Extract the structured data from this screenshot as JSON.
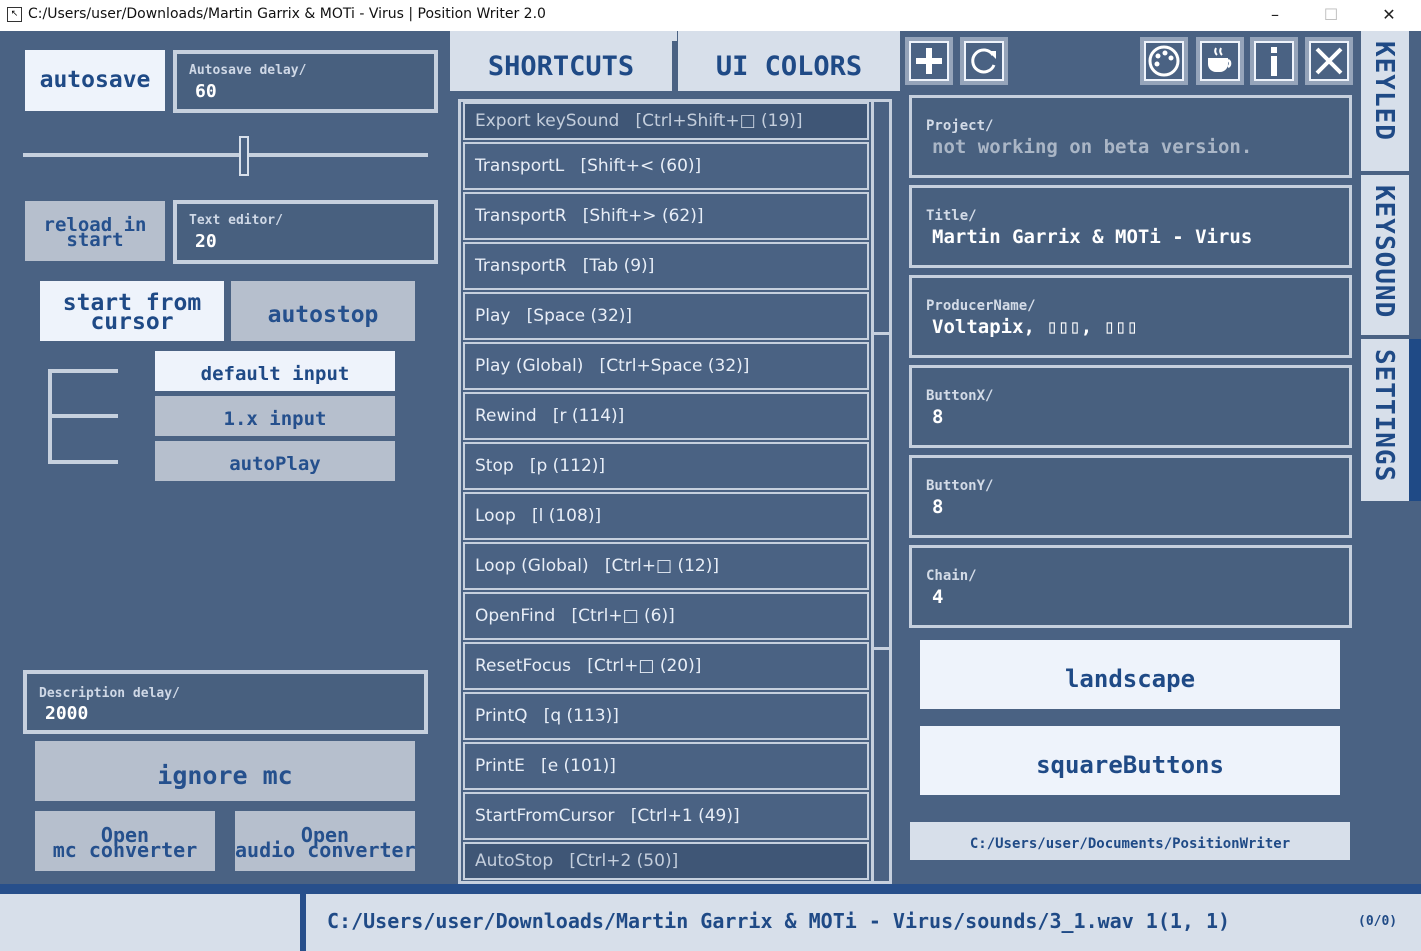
{
  "window": {
    "title": "C:/Users/user/Downloads/Martin Garrix & MOTi - Virus | Position Writer 2.0",
    "minimize_glyph": "–",
    "maximize_glyph": "☐",
    "close_glyph": "✕"
  },
  "left": {
    "autosave_label": "autosave",
    "autosave_delay": {
      "label": "Autosave delay/",
      "value": "60"
    },
    "slider_level": 0.55,
    "reload_label_1": "reload in",
    "reload_label_2": "start",
    "text_editor": {
      "label": "Text editor/",
      "value": "20"
    },
    "start_from_cursor_1": "start from",
    "start_from_cursor_2": "cursor",
    "autostop_label": "autostop",
    "input_options": [
      "default input",
      "1.x input",
      "autoPlay"
    ],
    "description_delay": {
      "label": "Description delay/",
      "value": "2000"
    },
    "ignore_mc_label": "ignore mc",
    "mc_converter_1": "Open",
    "mc_converter_2": "mc converter",
    "audio_converter_1": "Open",
    "audio_converter_2": "audio converter"
  },
  "tabs": {
    "shortcuts": "SHORTCUTS",
    "ui_colors": "UI COLORS"
  },
  "shortcuts": [
    "Export keySound   [Ctrl+Shift+□ (19)]",
    "TransportL   [Shift+< (60)]",
    "TransportR   [Shift+> (62)]",
    "TransportR   [Tab (9)]",
    "Play   [Space (32)]",
    "Play (Global)   [Ctrl+Space (32)]",
    "Rewind   [r (114)]",
    "Stop   [p (112)]",
    "Loop   [l (108)]",
    "Loop (Global)   [Ctrl+□ (12)]",
    "OpenFind   [Ctrl+□ (6)]",
    "ResetFocus   [Ctrl+□ (20)]",
    "PrintQ   [q (113)]",
    "PrintE   [e (101)]",
    "StartFromCursor   [Ctrl+1 (49)]",
    "AutoStop   [Ctrl+2 (50)]"
  ],
  "right": {
    "fields": [
      {
        "label": "Project/",
        "value": "not working on beta version."
      },
      {
        "label": "Title/",
        "value": "Martin Garrix & MOTi - Virus"
      },
      {
        "label": "ProducerName/",
        "value": "Voltapix, ▯▯▯, ▯▯▯"
      },
      {
        "label": "ButtonX/",
        "value": "8"
      },
      {
        "label": "ButtonY/",
        "value": "8"
      },
      {
        "label": "Chain/",
        "value": "4"
      }
    ],
    "landscape_label": "landscape",
    "square_buttons_label": "squareButtons",
    "path_label": "C:/Users/user/Documents/PositionWriter"
  },
  "toolbar_icons": [
    "plus-icon",
    "refresh-icon",
    "palette-icon",
    "coffee-icon",
    "info-icon",
    "close-icon"
  ],
  "side_tabs": {
    "keyled": "KEYLED",
    "keysound": "KEYSOUND",
    "settings": "SETTINGS"
  },
  "status": {
    "path": "C:/Users/user/Downloads/Martin Garrix & MOTi - Virus/sounds/3_1.wav 1(1, 1)",
    "count": "(0/0)"
  },
  "colors": {
    "background": "#4a6283",
    "accent": "#1f4a86",
    "light": "#eef3fb",
    "gray": "#b6bfcd"
  }
}
